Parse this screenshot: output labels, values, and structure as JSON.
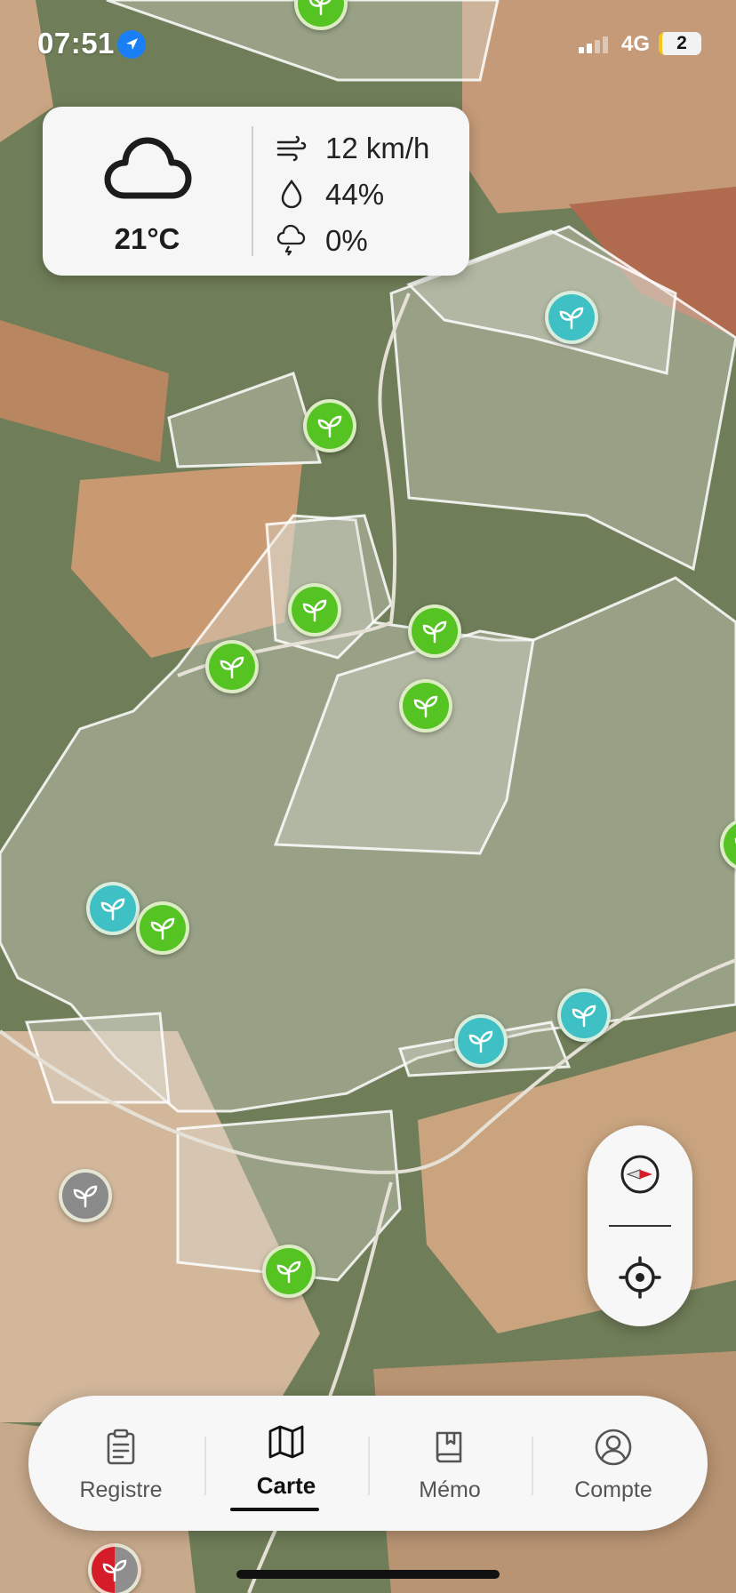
{
  "status_bar": {
    "time": "07:51",
    "network": "4G",
    "battery": "2"
  },
  "weather": {
    "temperature": "21°C",
    "wind": "12 km/h",
    "humidity": "44%",
    "precipitation": "0%",
    "condition_icon": "cloud-icon"
  },
  "map": {
    "markers": [
      {
        "id": "parcel-1",
        "status": "green"
      },
      {
        "id": "parcel-2",
        "status": "teal"
      },
      {
        "id": "parcel-3",
        "status": "green"
      },
      {
        "id": "parcel-4",
        "status": "green"
      },
      {
        "id": "parcel-5",
        "status": "green"
      },
      {
        "id": "parcel-6",
        "status": "green"
      },
      {
        "id": "parcel-7",
        "status": "green"
      },
      {
        "id": "parcel-8",
        "status": "green"
      },
      {
        "id": "parcel-9",
        "status": "teal"
      },
      {
        "id": "parcel-10",
        "status": "green"
      },
      {
        "id": "parcel-11",
        "status": "teal"
      },
      {
        "id": "parcel-12",
        "status": "teal"
      },
      {
        "id": "parcel-13",
        "status": "gray"
      },
      {
        "id": "parcel-14",
        "status": "green"
      },
      {
        "id": "parcel-15",
        "status": "red-gray"
      }
    ],
    "controls": {
      "compass_icon": "compass-icon",
      "locate_icon": "locate-icon"
    }
  },
  "tabbar": {
    "tabs": [
      {
        "label": "Registre",
        "icon": "clipboard-icon",
        "active": false
      },
      {
        "label": "Carte",
        "icon": "map-icon",
        "active": true
      },
      {
        "label": "Mémo",
        "icon": "book-icon",
        "active": false
      },
      {
        "label": "Compte",
        "icon": "user-circle-icon",
        "active": false
      }
    ]
  },
  "colors": {
    "marker_green": "#55c423",
    "marker_teal": "#3fc0c4",
    "marker_gray": "#8a8a8a",
    "marker_red": "#d51d2a"
  }
}
